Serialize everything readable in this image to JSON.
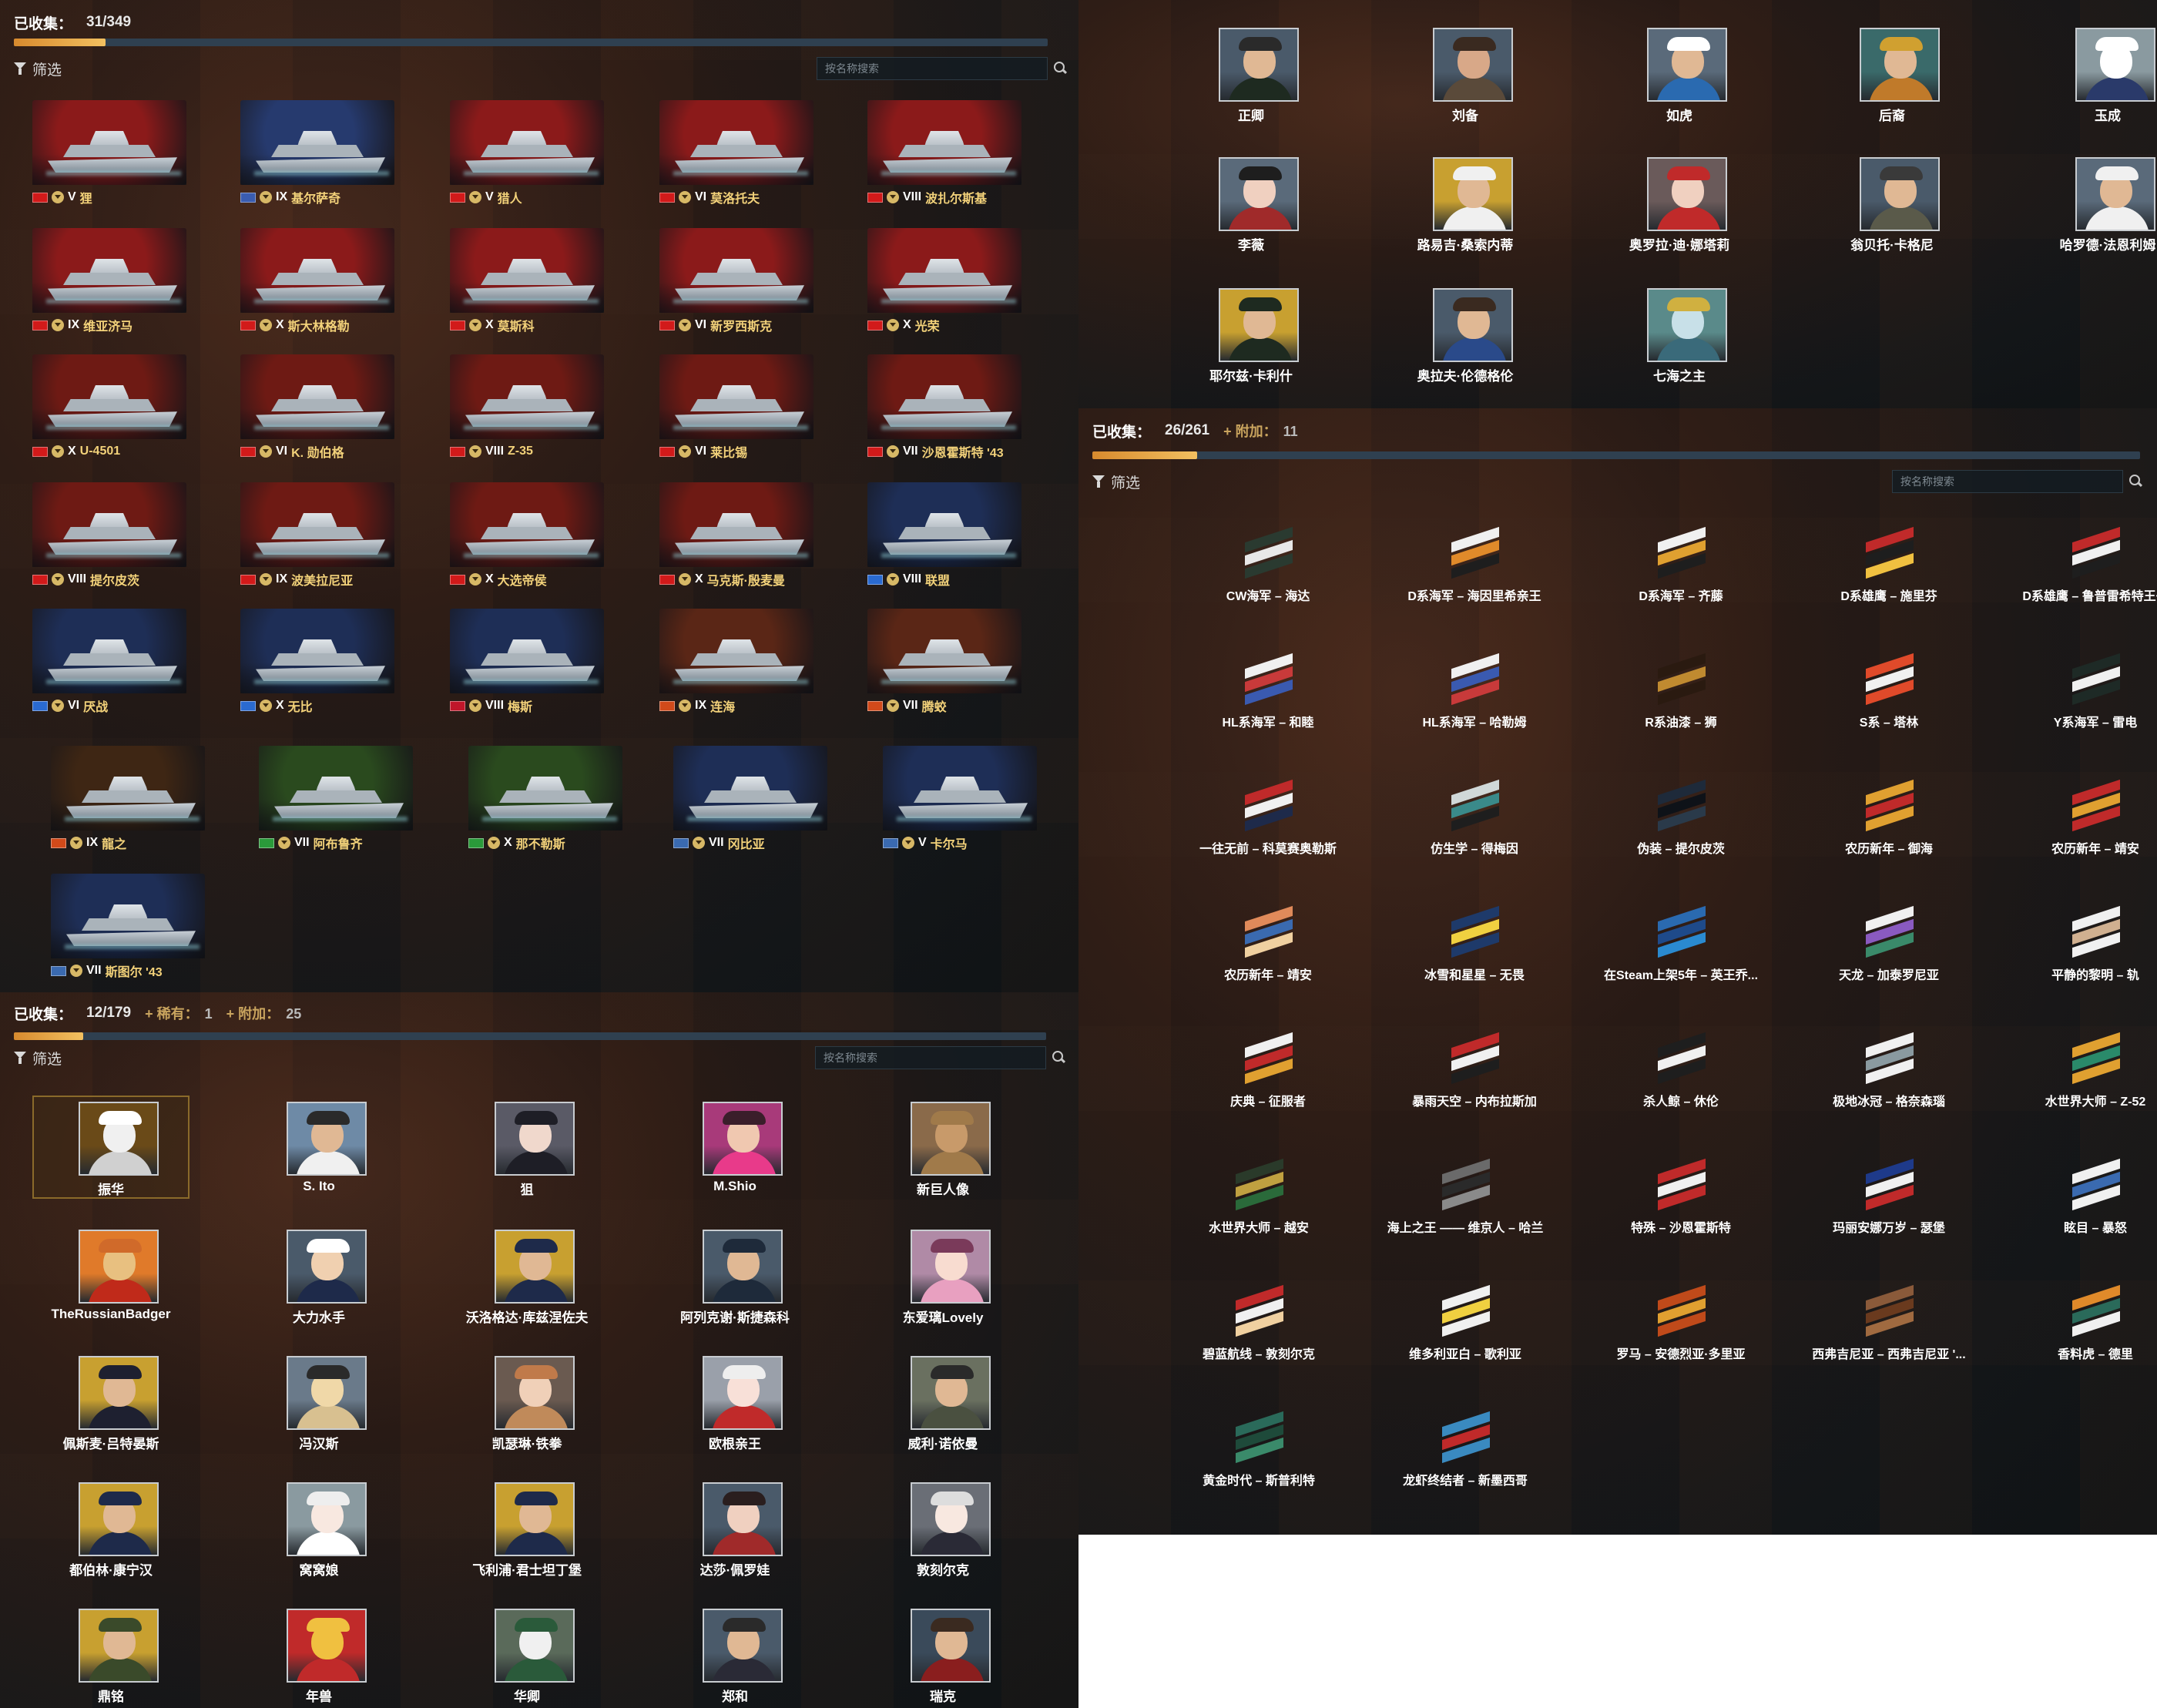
{
  "ships_panel": {
    "summary_label": "已收集：",
    "summary_value": "31/349",
    "progress": 0.089,
    "filter_label": "筛选",
    "search_placeholder": "按名称搜索",
    "ships": [
      {
        "tier": "V",
        "name": "狸",
        "flag_color": "#8b1a1a",
        "nation_color": "#d21a1a"
      },
      {
        "tier": "IX",
        "name": "基尔萨奇",
        "flag_color": "#263a6e",
        "nation_color": "#3a5cb0"
      },
      {
        "tier": "V",
        "name": "猎人",
        "flag_color": "#8b1a1a",
        "nation_color": "#d21a1a"
      },
      {
        "tier": "VI",
        "name": "莫洛托夫",
        "flag_color": "#8b1a1a",
        "nation_color": "#d21a1a"
      },
      {
        "tier": "VIII",
        "name": "波扎尔斯基",
        "flag_color": "#8b1a1a",
        "nation_color": "#d21a1a"
      },
      {
        "tier": "IX",
        "name": "维亚济马",
        "flag_color": "#8b1a1a",
        "nation_color": "#d21a1a"
      },
      {
        "tier": "X",
        "name": "斯大林格勒",
        "flag_color": "#8b1a1a",
        "nation_color": "#d21a1a"
      },
      {
        "tier": "X",
        "name": "莫斯科",
        "flag_color": "#8b1a1a",
        "nation_color": "#d21a1a"
      },
      {
        "tier": "VI",
        "name": "新罗西斯克",
        "flag_color": "#8b1a1a",
        "nation_color": "#d21a1a"
      },
      {
        "tier": "X",
        "name": "光荣",
        "flag_color": "#8b1a1a",
        "nation_color": "#d21a1a"
      },
      {
        "tier": "X",
        "name": "U-4501",
        "flag_color": "#6e1a14",
        "nation_color": "#d21a1a"
      },
      {
        "tier": "VI",
        "name": "K. 勋伯格",
        "flag_color": "#6e1a14",
        "nation_color": "#d21a1a"
      },
      {
        "tier": "VIII",
        "name": "Z-35",
        "flag_color": "#6e1a14",
        "nation_color": "#d21a1a"
      },
      {
        "tier": "VI",
        "name": "莱比锡",
        "flag_color": "#6e1a14",
        "nation_color": "#d21a1a"
      },
      {
        "tier": "VII",
        "name": "沙恩霍斯特 '43",
        "flag_color": "#6e1a14",
        "nation_color": "#d21a1a"
      },
      {
        "tier": "VIII",
        "name": "提尔皮茨",
        "flag_color": "#6e1a14",
        "nation_color": "#d21a1a"
      },
      {
        "tier": "IX",
        "name": "波美拉尼亚",
        "flag_color": "#6e1a14",
        "nation_color": "#d21a1a"
      },
      {
        "tier": "X",
        "name": "大选帝侯",
        "flag_color": "#6e1a14",
        "nation_color": "#d21a1a"
      },
      {
        "tier": "X",
        "name": "马克斯·殷麦曼",
        "flag_color": "#6e1a14",
        "nation_color": "#d21a1a"
      },
      {
        "tier": "VIII",
        "name": "联盟",
        "flag_color": "#1e2e56",
        "nation_color": "#2a6ad0"
      },
      {
        "tier": "VI",
        "name": "厌战",
        "flag_color": "#1e2e56",
        "nation_color": "#2a6ad0"
      },
      {
        "tier": "X",
        "name": "无比",
        "flag_color": "#1e2e56",
        "nation_color": "#2a6ad0"
      },
      {
        "tier": "VIII",
        "name": "梅斯",
        "flag_color": "#1e2e56",
        "nation_color": "#c0162a"
      },
      {
        "tier": "IX",
        "name": "连海",
        "flag_color": "#5a2616",
        "nation_color": "#d24a1a"
      },
      {
        "tier": "VII",
        "name": "腾蛟",
        "flag_color": "#5a2616",
        "nation_color": "#d24a1a"
      },
      {
        "tier": "IX",
        "name": "龍之",
        "flag_color": "#3e2614",
        "nation_color": "#d24a1a"
      },
      {
        "tier": "VII",
        "name": "阿布鲁齐",
        "flag_color": "#2a4a1e",
        "nation_color": "#2a9a3a"
      },
      {
        "tier": "X",
        "name": "那不勒斯",
        "flag_color": "#2a4a1e",
        "nation_color": "#2a9a3a"
      },
      {
        "tier": "VII",
        "name": "冈比亚",
        "flag_color": "#1e2e56",
        "nation_color": "#3a6ab0"
      },
      {
        "tier": "V",
        "name": "卡尔马",
        "flag_color": "#1e2e56",
        "nation_color": "#3a6ab0"
      },
      {
        "tier": "VII",
        "name": "斯图尔 '43",
        "flag_color": "#1e2e56",
        "nation_color": "#3a6ab0"
      }
    ]
  },
  "commanders_panel": {
    "summary_label": "已收集：",
    "summary_value": "12/179",
    "rare_label": "+ 稀有：",
    "rare_value": "1",
    "extra_label": "+ 附加：",
    "extra_value": "25",
    "progress": 0.067,
    "filter_label": "筛选",
    "search_placeholder": "按名称搜索",
    "commanders": [
      {
        "name": "振华",
        "bg": "#6a4a18",
        "skin": "#f0f0f0",
        "body": "#d0d0d0",
        "hat": "#ffffff"
      },
      {
        "name": "S. Ito",
        "bg": "#6e8aa6",
        "skin": "#e0b894",
        "body": "#f0f0f0",
        "hat": "#2a2a2a"
      },
      {
        "name": "狙",
        "bg": "#5a5a66",
        "skin": "#f0d8cc",
        "body": "#1e1e26",
        "hat": "#1e1e26"
      },
      {
        "name": "M.Shio",
        "bg": "#a83a7a",
        "skin": "#f0c8b0",
        "body": "#e83a8a",
        "hat": "#3a1e2a"
      },
      {
        "name": "新巨人像",
        "bg": "#8a6a4a",
        "skin": "#c89a6a",
        "body": "#a07a4a",
        "hat": "#a07a4a"
      },
      {
        "name": "TheRussianBadger",
        "bg": "#e07a2a",
        "skin": "#e8c080",
        "body": "#c02a1a",
        "hat": "#d06a2a"
      },
      {
        "name": "大力水手",
        "bg": "#4a5a6a",
        "skin": "#f0d0b0",
        "body": "#1e2a4a",
        "hat": "#ffffff"
      },
      {
        "name": "沃洛格达·库兹涅佐夫",
        "bg": "#c8a030",
        "skin": "#e0b894",
        "body": "#1e2a4a",
        "hat": "#1e2a4a"
      },
      {
        "name": "阿列克谢·斯捷森科",
        "bg": "#4a5a6a",
        "skin": "#e0b894",
        "body": "#1e2a3a",
        "hat": "#1e2a3a"
      },
      {
        "name": "东爱璃Lovely",
        "bg": "#b08aa6",
        "skin": "#f8dcd0",
        "body": "#e8a0c0",
        "hat": "#7a3a5a"
      },
      {
        "name": "佩斯麦·吕特晏斯",
        "bg": "#c8a030",
        "skin": "#e0b894",
        "body": "#1e2030",
        "hat": "#1e2030"
      },
      {
        "name": "冯汉斯",
        "bg": "#6a7a8a",
        "skin": "#f0d8a8",
        "body": "#d8c090",
        "hat": "#2a2a2a"
      },
      {
        "name": "凯瑟琳·铁拳",
        "bg": "#6a5a50",
        "skin": "#f0d0b8",
        "body": "#c08a5a",
        "hat": "#c07a4a"
      },
      {
        "name": "欧根亲王",
        "bg": "#9aa0aa",
        "skin": "#f8e0d8",
        "body": "#c02a2a",
        "hat": "#eeeeee"
      },
      {
        "name": "威利·诺依曼",
        "bg": "#6a7060",
        "skin": "#e0b894",
        "body": "#4a5040",
        "hat": "#2a2a2a"
      },
      {
        "name": "都伯林·康宁汉",
        "bg": "#c8a030",
        "skin": "#e0b894",
        "body": "#1e2a4a",
        "hat": "#1e2a4a"
      },
      {
        "name": "窝窝娘",
        "bg": "#8a9aa0",
        "skin": "#f8e8e0",
        "body": "#ffffff",
        "hat": "#eeeeee"
      },
      {
        "name": "飞利浦·君士坦丁堡",
        "bg": "#c8a030",
        "skin": "#e0b894",
        "body": "#1e2a4a",
        "hat": "#1e2a4a"
      },
      {
        "name": "达莎·佩罗娃",
        "bg": "#4a5a6a",
        "skin": "#f0d0c0",
        "body": "#a02a2a",
        "hat": "#2a1e1e"
      },
      {
        "name": "敦刻尔克",
        "bg": "#6a6e76",
        "skin": "#f8e8e0",
        "body": "#2a2a36",
        "hat": "#dddddd"
      },
      {
        "name": "鼎铭",
        "bg": "#c8a030",
        "skin": "#e0b894",
        "body": "#3a4a2a",
        "hat": "#3a4a2a"
      },
      {
        "name": "年兽",
        "bg": "#c02a2a",
        "skin": "#f0c040",
        "body": "#c02a2a",
        "hat": "#f0c040"
      },
      {
        "name": "华卿",
        "bg": "#5a6a5a",
        "skin": "#f0f0f0",
        "body": "#2a5a3a",
        "hat": "#2a5a3a"
      },
      {
        "name": "郑和",
        "bg": "#4a5a6a",
        "skin": "#e0b894",
        "body": "#2a2a36",
        "hat": "#2a2a2a"
      },
      {
        "name": "瑞克",
        "bg": "#3a4a5a",
        "skin": "#e0b894",
        "body": "#8a1e1e",
        "hat": "#3a2a20"
      }
    ]
  },
  "commanders_top_panel": {
    "commanders": [
      {
        "name": "正卿",
        "bg": "#4a5a6a",
        "skin": "#e0b894",
        "body": "#1e2a20",
        "hat": "#2a2a2a"
      },
      {
        "name": "刘备",
        "bg": "#4a5a6a",
        "skin": "#d8a888",
        "body": "#5a4a3a",
        "hat": "#3a2a20"
      },
      {
        "name": "如虎",
        "bg": "#5a6a7a",
        "skin": "#e0b894",
        "body": "#2a6ab0",
        "hat": "#ffffff"
      },
      {
        "name": "后裔",
        "bg": "#3a6a6a",
        "skin": "#e0b894",
        "body": "#c07a2a",
        "hat": "#d0a030"
      },
      {
        "name": "玉成",
        "bg": "#8a9aa0",
        "skin": "#ffffff",
        "body": "#2a3a6a",
        "hat": "#ffffff"
      },
      {
        "name": "李薇",
        "bg": "#5a6a7a",
        "skin": "#f0d0c0",
        "body": "#a02a2a",
        "hat": "#1e1e1e"
      },
      {
        "name": "路易吉·桑索内蒂",
        "bg": "#c8a030",
        "skin": "#e0b894",
        "body": "#f0f0f0",
        "hat": "#f0f0f0"
      },
      {
        "name": "奥罗拉·迪·娜塔莉",
        "bg": "#6a5a5a",
        "skin": "#f0d0c0",
        "body": "#c02a2a",
        "hat": "#c02a2a"
      },
      {
        "name": "翁贝托·卡格尼",
        "bg": "#4a5a6a",
        "skin": "#e0b894",
        "body": "#5a5a4a",
        "hat": "#3a3a3a"
      },
      {
        "name": "哈罗德·法恩利姆",
        "bg": "#5a6a7a",
        "skin": "#e0b894",
        "body": "#f0f0f0",
        "hat": "#f0f0f0"
      },
      {
        "name": "耶尔兹·卡利什",
        "bg": "#c8a030",
        "skin": "#e0b894",
        "body": "#1e2a20",
        "hat": "#1e2a20"
      },
      {
        "name": "奥拉夫·伦德格伦",
        "bg": "#4a5a6a",
        "skin": "#e0b894",
        "body": "#2a4a8a",
        "hat": "#3a2a20"
      },
      {
        "name": "七海之主",
        "bg": "#5a8a8a",
        "skin": "#c8e0e8",
        "body": "#3a6a7a",
        "hat": "#d0b040"
      }
    ]
  },
  "permacamo_panel": {
    "summary_label": "已收集：",
    "summary_value": "26/261",
    "extra_label": "+ 附加：",
    "extra_value": "11",
    "progress": 0.1,
    "filter_label": "筛选",
    "search_placeholder": "按名称搜索",
    "camos": [
      {
        "name": "CW海军 – 海达",
        "colors": [
          "#2a3a30",
          "#e8e8e8",
          "#2a3a30"
        ]
      },
      {
        "name": "D系海军 – 海因里希亲王",
        "colors": [
          "#f0f0f0",
          "#e08a2a",
          "#1e1e1e"
        ]
      },
      {
        "name": "D系海军 – 齐藤",
        "colors": [
          "#f0f0f0",
          "#e0a030",
          "#1e1e1e"
        ]
      },
      {
        "name": "D系雄鹰 – 施里芬",
        "colors": [
          "#c02a2a",
          "#1e1e1e",
          "#f0c040"
        ]
      },
      {
        "name": "D系雄鹰 – 鲁普雷希特王子",
        "colors": [
          "#c02a2a",
          "#f0f0f0",
          "#1e1e1e"
        ]
      },
      {
        "name": "HL系海军 – 和睦",
        "colors": [
          "#f0f0f0",
          "#c83a3a",
          "#3a5ab0"
        ]
      },
      {
        "name": "HL系海军 – 哈勒姆",
        "colors": [
          "#f0f0f0",
          "#3a5ab0",
          "#c83a3a"
        ]
      },
      {
        "name": "R系油漆 – 狮",
        "colors": [
          "#2a1a10",
          "#c08a30",
          "#2a1a10"
        ]
      },
      {
        "name": "S系 – 塔林",
        "colors": [
          "#e04a2a",
          "#f0f0f0",
          "#e04a2a"
        ]
      },
      {
        "name": "Y系海军 – 雷电",
        "colors": [
          "#1e2a26",
          "#f0f0f0",
          "#1e2a26"
        ]
      },
      {
        "name": "一往无前 – 科莫赛奥勒斯",
        "colors": [
          "#c02a2a",
          "#f0f0f0",
          "#1e2a4a"
        ]
      },
      {
        "name": "仿生学 – 得梅因",
        "colors": [
          "#d0d8d8",
          "#3a8a8a",
          "#1e1e1e"
        ]
      },
      {
        "name": "伪装 – 提尔皮茨",
        "colors": [
          "#1e2a3a",
          "#0e1218",
          "#2a3a4a"
        ]
      },
      {
        "name": "农历新年 – 御海",
        "colors": [
          "#e0a030",
          "#c02a2a",
          "#e0a030"
        ]
      },
      {
        "name": "农历新年 – 靖安",
        "colors": [
          "#c02a2a",
          "#e0a030",
          "#c02a2a"
        ]
      },
      {
        "name": "农历新年 – 靖安",
        "colors": [
          "#e08a5a",
          "#3a6ab0",
          "#f0d0a0"
        ]
      },
      {
        "name": "冰雪和星星 – 无畏",
        "colors": [
          "#1e3a6a",
          "#f0d040",
          "#1e3a6a"
        ]
      },
      {
        "name": "在Steam上架5年 – 英王乔...",
        "colors": [
          "#2a6ab0",
          "#1e4a8a",
          "#2a8ad0"
        ]
      },
      {
        "name": "天龙 – 加泰罗尼亚",
        "colors": [
          "#f0f0f0",
          "#8a5ac0",
          "#3a8a6a"
        ]
      },
      {
        "name": "平静的黎明 – 轨",
        "colors": [
          "#f0f0f0",
          "#d0b090",
          "#f0f0f0"
        ]
      },
      {
        "name": "庆典 – 征服者",
        "colors": [
          "#f0f0f0",
          "#c02a2a",
          "#e0a030"
        ]
      },
      {
        "name": "暴雨天空 – 内布拉斯加",
        "colors": [
          "#c02a2a",
          "#f0f0f0",
          "#1e1e1e"
        ]
      },
      {
        "name": "杀人鲸 – 休伦",
        "colors": [
          "#1e1e1e",
          "#f0f0f0",
          "#1e1e1e"
        ]
      },
      {
        "name": "极地冰冠 – 格奈森瑙",
        "colors": [
          "#f0f0f0",
          "#8a9aa0",
          "#f0f0f0"
        ]
      },
      {
        "name": "水世界大师 – Z-52",
        "colors": [
          "#e0a030",
          "#2a8a6a",
          "#e0a030"
        ]
      },
      {
        "name": "水世界大师 – 越安",
        "colors": [
          "#2a3a2a",
          "#c0a040",
          "#2a6a3a"
        ]
      },
      {
        "name": "海上之王 —— 维京人 – 哈兰",
        "colors": [
          "#6a6a6a",
          "#2a2a2a",
          "#8a8a8a"
        ]
      },
      {
        "name": "特殊 – 沙恩霍斯特",
        "colors": [
          "#c02a2a",
          "#f0f0f0",
          "#c02a2a"
        ]
      },
      {
        "name": "玛丽安娜万岁 – 瑟堡",
        "colors": [
          "#1e3a8a",
          "#f0f0f0",
          "#c02a2a"
        ]
      },
      {
        "name": "眩目 – 暴怒",
        "colors": [
          "#f0f0f0",
          "#3a6ab0",
          "#f0f0f0"
        ]
      },
      {
        "name": "碧蓝航线 – 敦刻尔克",
        "colors": [
          "#c02a2a",
          "#f0f0f0",
          "#f0d0a0"
        ]
      },
      {
        "name": "维多利亚白 – 歌利亚",
        "colors": [
          "#f0f0f0",
          "#f0d040",
          "#f0f0f0"
        ]
      },
      {
        "name": "罗马 – 安德烈亚·多里亚",
        "colors": [
          "#c04a1a",
          "#e0a030",
          "#c04a1a"
        ]
      },
      {
        "name": "西弗吉尼亚 – 西弗吉尼亚 '...",
        "colors": [
          "#8a5a3a",
          "#6a3a1e",
          "#a06a40"
        ]
      },
      {
        "name": "香料虎 – 德里",
        "colors": [
          "#e08a2a",
          "#2a6a5a",
          "#f0f0f0"
        ]
      },
      {
        "name": "黄金时代 – 斯普利特",
        "colors": [
          "#2a6a5a",
          "#1e4a3a",
          "#3a8a6a"
        ]
      },
      {
        "name": "龙虾终结者 – 新墨西哥",
        "colors": [
          "#3a8ac0",
          "#c02a2a",
          "#3a8ac0"
        ]
      }
    ]
  }
}
